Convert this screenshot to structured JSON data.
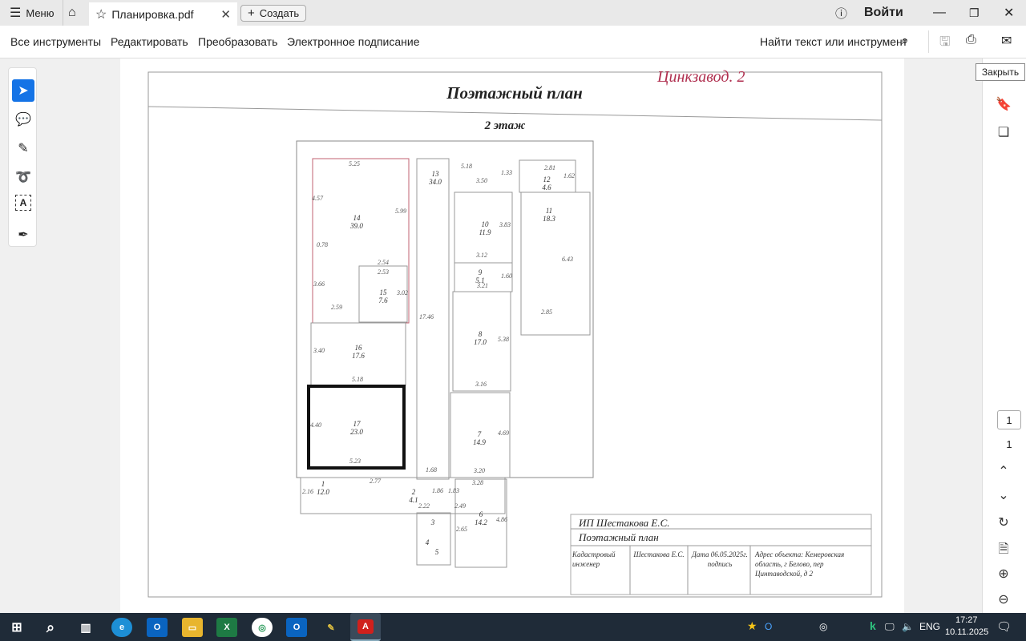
{
  "tabbar": {
    "menu": "Меню",
    "tab_title": "Планировка.pdf",
    "create": "Создать",
    "signin": "Войти"
  },
  "toolbar": {
    "items": [
      "Все инструменты",
      "Редактировать",
      "Преобразовать",
      "Электронное подписание"
    ],
    "search": "Найти текст или инструмент"
  },
  "tooltip": "Закрыть",
  "pager": {
    "current": "1",
    "total": "1"
  },
  "document": {
    "handwritten": "Цинкзавод. 2",
    "title": "Поэтажный план",
    "floor": "2 этаж",
    "rooms": [
      {
        "n": "14",
        "a": "39.0"
      },
      {
        "n": "15",
        "a": "7.6"
      },
      {
        "n": "16",
        "a": "17.6"
      },
      {
        "n": "17",
        "a": "23.0"
      },
      {
        "n": "13",
        "a": "34.0"
      },
      {
        "n": "10",
        "a": "11.9"
      },
      {
        "n": "9",
        "a": "5.1"
      },
      {
        "n": "8",
        "a": "17.0"
      },
      {
        "n": "7",
        "a": "14.9"
      },
      {
        "n": "12",
        "a": "4.6"
      },
      {
        "n": "11",
        "a": "18.3"
      },
      {
        "n": "1",
        "a": "12.0"
      },
      {
        "n": "2",
        "a": "4.1"
      },
      {
        "n": "6",
        "a": "14.2"
      },
      {
        "n": "3",
        "a": ""
      },
      {
        "n": "4",
        "a": ""
      },
      {
        "n": "5",
        "a": ""
      }
    ],
    "dims": [
      "5.25",
      "5.99",
      "4.57",
      "0.78",
      "2.54",
      "2.53",
      "3.66",
      "3.02",
      "2.59",
      "3.40",
      "5.18",
      "4.40",
      "5.23",
      "5.18",
      "1.33",
      "3.50",
      "2.81",
      "1.62",
      "3.83",
      "3.12",
      "1.60",
      "3.21",
      "5.38",
      "3.16",
      "4.69",
      "3.20",
      "6.43",
      "2.85",
      "17.46",
      "1.68",
      "2.77",
      "2.16",
      "1.86",
      "1.83",
      "3.28",
      "2.22",
      "2.49",
      "4.86",
      "2.65"
    ],
    "stamp": {
      "org": "ИП Шестакова Е.С.",
      "doc": "Поэтажный план",
      "role": "Кадастровый инженер",
      "name": "Шестакова Е.С.",
      "date": "Дата 06.05.2025г. подпись",
      "address": "Адрес объекта: Кемеровская область, г Белово, пер Цинтаводской, д 2"
    }
  },
  "taskbar": {
    "lang": "ENG",
    "time": "17:27",
    "date": "10.11.2025"
  }
}
